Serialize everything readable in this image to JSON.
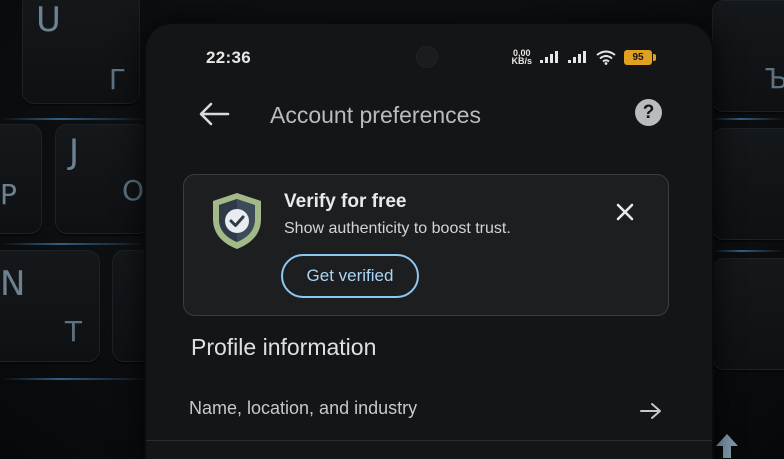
{
  "background": {
    "keys": [
      {
        "latin": "U",
        "cyrillic": "Г"
      },
      {
        "latin": "J",
        "cyrillic": "О"
      },
      {
        "latin": "N",
        "cyrillic": "Т"
      },
      {
        "latin": "P",
        "cyrillic": ""
      },
      {
        "latin": "",
        "cyrillic": "Ъ"
      }
    ]
  },
  "status_bar": {
    "time": "22:36",
    "net_speed_value": "0,00",
    "net_speed_unit": "KB/s",
    "battery_level": "95",
    "battery_color": "#e0a020"
  },
  "app_bar": {
    "back_icon": "arrow-left-icon",
    "title": "Account preferences",
    "help_label": "?"
  },
  "verify_card": {
    "icon": "shield-check-icon",
    "title": "Verify for free",
    "subtitle": "Show authenticity to boost trust.",
    "button_label": "Get verified",
    "close_icon": "close-icon",
    "accent_color": "#8ec7f0"
  },
  "profile_section": {
    "title": "Profile information",
    "rows": [
      {
        "label": "Name, location, and industry",
        "icon": "arrow-right-icon"
      }
    ]
  }
}
